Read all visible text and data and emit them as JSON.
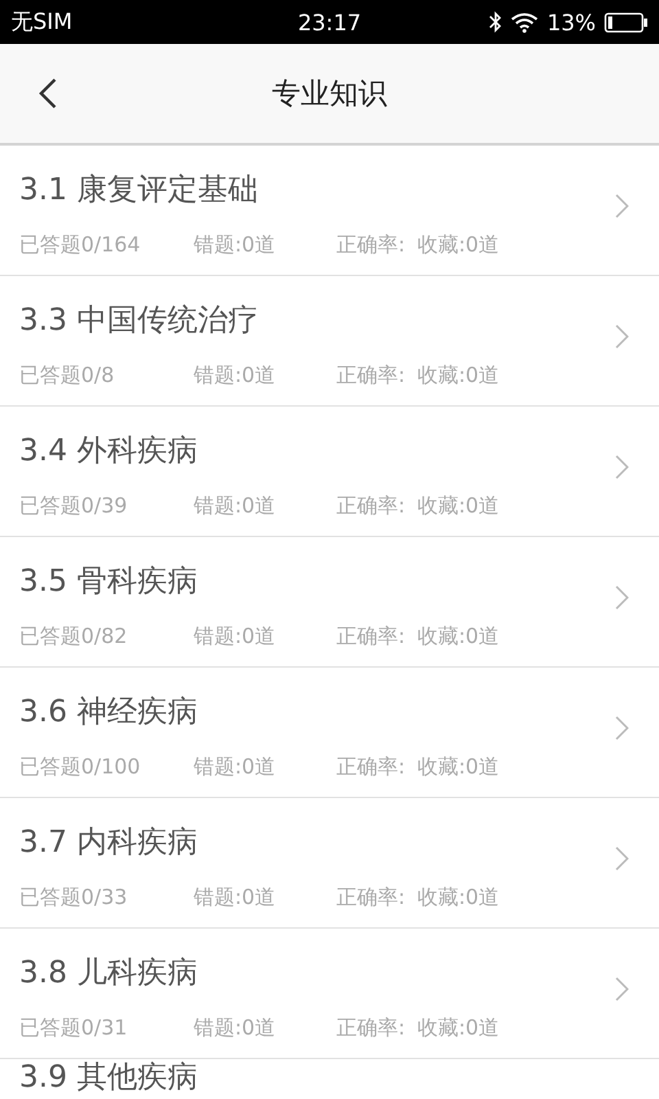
{
  "status_bar": {
    "carrier": "无SIM",
    "time": "23:17",
    "battery": "13%"
  },
  "header": {
    "title": "专业知识"
  },
  "items": [
    {
      "title": "3.1 康复评定基础",
      "answered": "已答题0/164",
      "wrong": "错题:0道",
      "accuracy": "正确率:",
      "favorites": "收藏:0道"
    },
    {
      "title": "3.3 中国传统治疗",
      "answered": "已答题0/8",
      "wrong": "错题:0道",
      "accuracy": "正确率:",
      "favorites": "收藏:0道"
    },
    {
      "title": "3.4 外科疾病",
      "answered": "已答题0/39",
      "wrong": "错题:0道",
      "accuracy": "正确率:",
      "favorites": "收藏:0道"
    },
    {
      "title": "3.5 骨科疾病",
      "answered": "已答题0/82",
      "wrong": "错题:0道",
      "accuracy": "正确率:",
      "favorites": "收藏:0道"
    },
    {
      "title": "3.6 神经疾病",
      "answered": "已答题0/100",
      "wrong": "错题:0道",
      "accuracy": "正确率:",
      "favorites": "收藏:0道"
    },
    {
      "title": "3.7 内科疾病",
      "answered": "已答题0/33",
      "wrong": "错题:0道",
      "accuracy": "正确率:",
      "favorites": "收藏:0道"
    },
    {
      "title": "3.8 儿科疾病",
      "answered": "已答题0/31",
      "wrong": "错题:0道",
      "accuracy": "正确率:",
      "favorites": "收藏:0道"
    },
    {
      "title": "3.9 其他疾病"
    }
  ]
}
